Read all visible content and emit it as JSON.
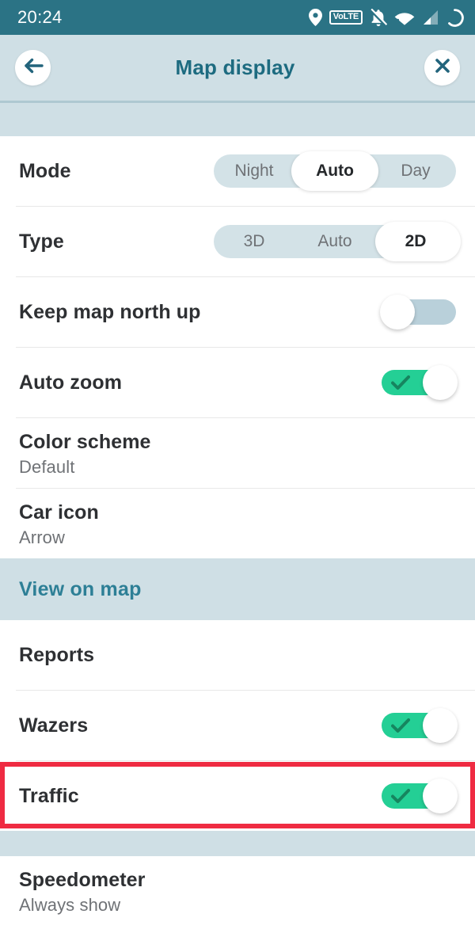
{
  "statusbar": {
    "time": "20:24",
    "icons": [
      {
        "name": "location-pin-icon"
      },
      {
        "name": "volte-badge-icon",
        "label": "VoLTE"
      },
      {
        "name": "notifications-muted-icon"
      },
      {
        "name": "wifi-icon"
      },
      {
        "name": "cellular-signal-icon"
      },
      {
        "name": "battery-charging-circle-icon"
      }
    ],
    "background": "#2b7385",
    "foreground": "#ffffff"
  },
  "appbar": {
    "title": "Map display",
    "back_icon": "arrow-left-icon",
    "close_icon": "close-icon",
    "background": "#cfdfe5",
    "title_color": "#1d6b80"
  },
  "settings": {
    "mode": {
      "label": "Mode",
      "options": [
        "Night",
        "Auto",
        "Day"
      ],
      "selected": "Auto",
      "selected_index": 1
    },
    "type": {
      "label": "Type",
      "options": [
        "3D",
        "Auto",
        "2D"
      ],
      "selected": "2D",
      "selected_index": 2
    },
    "keep_map_north_up": {
      "label": "Keep map north up",
      "state": "off"
    },
    "auto_zoom": {
      "label": "Auto zoom",
      "state": "on"
    },
    "color_scheme": {
      "label": "Color scheme",
      "value": "Default"
    },
    "car_icon": {
      "label": "Car icon",
      "value": "Arrow"
    }
  },
  "view_on_map": {
    "section_title": "View on map",
    "reports": {
      "label": "Reports"
    },
    "wazers": {
      "label": "Wazers",
      "state": "on"
    },
    "traffic": {
      "label": "Traffic",
      "state": "on",
      "highlighted": true
    }
  },
  "speedometer": {
    "label": "Speedometer",
    "value": "Always show"
  },
  "colors": {
    "toggle_on": "#24cf95",
    "toggle_on_check": "#16855f",
    "toggle_off_track": "#b9d0da",
    "segment_track": "#d3e2e7",
    "band": "#cfdfe5",
    "accent_teal": "#2d7f96",
    "highlight_red": "#ef2b42",
    "label_text": "#2e3033",
    "sub_text": "#6f7276"
  }
}
